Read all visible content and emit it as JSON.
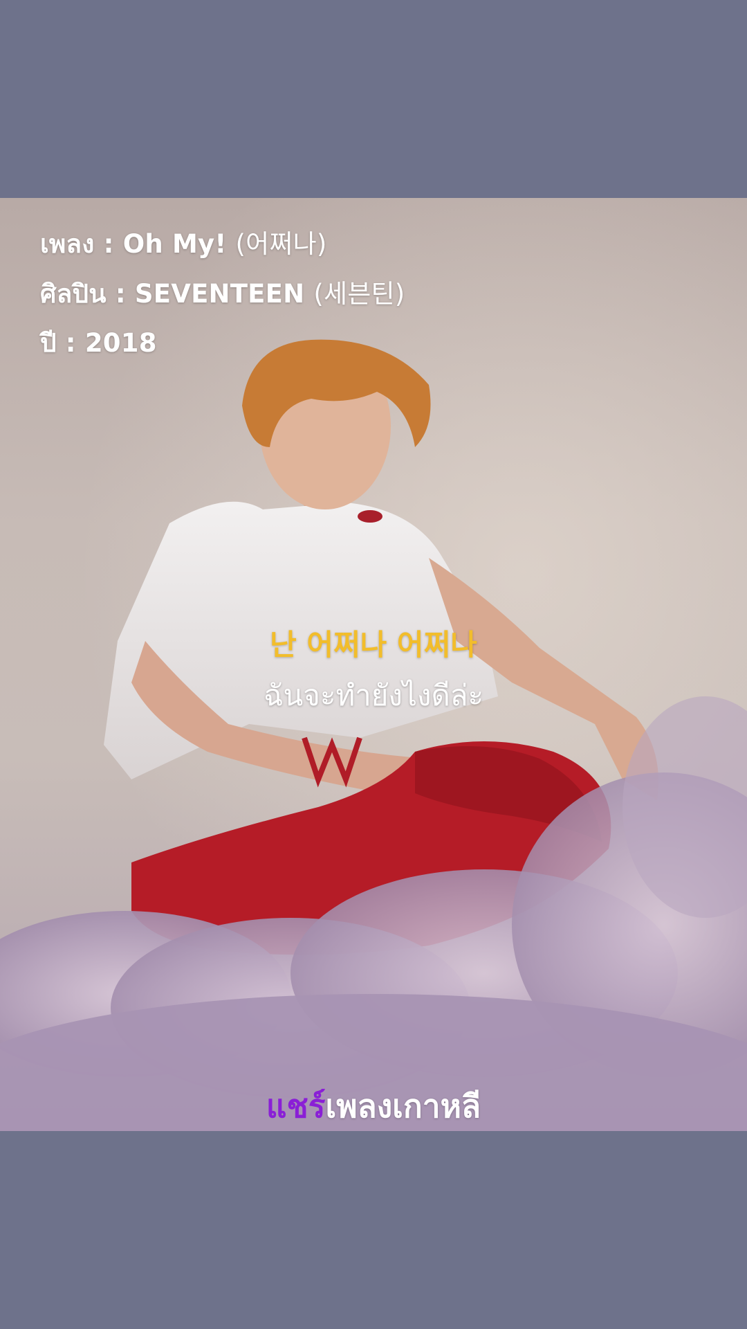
{
  "video": {
    "song_label": "เพลง : ",
    "song_title": "Oh My! ",
    "song_korean": "(어쩌나)",
    "artist_label": "ศิลปิน : ",
    "artist_name": "SEVENTEEN ",
    "artist_korean": "(세븐틴)",
    "year_label": "ปี : ",
    "year_value": "2018"
  },
  "lyrics": {
    "korean": "난 어쩌나 어쩌나",
    "thai": "ฉันจะทำยังไงดีล่ะ"
  },
  "brand": {
    "accent": "แชร์",
    "rest": "เพลงเกาหลี"
  },
  "colors": {
    "page_background": "#6e728b",
    "lyric_korean": "#f2bd2b",
    "brand_accent": "#8a1fd6"
  }
}
